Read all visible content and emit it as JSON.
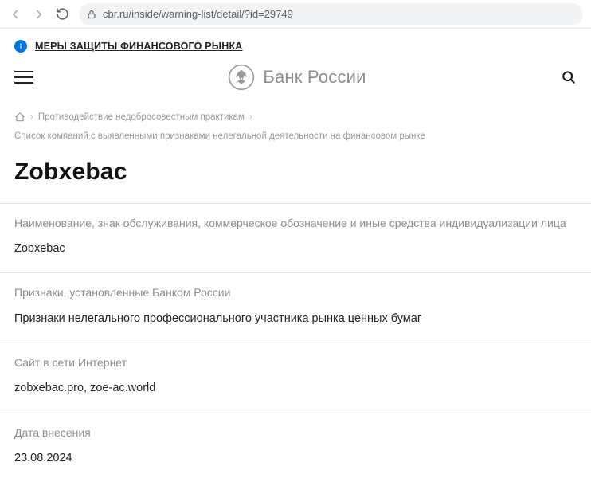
{
  "browser": {
    "url": "cbr.ru/inside/warning-list/detail/?id=29749"
  },
  "notice": {
    "text": "МЕРЫ ЗАЩИТЫ ФИНАНСОВОГО РЫНКА"
  },
  "brand": {
    "name": "Банк России"
  },
  "breadcrumb": {
    "item1": "Противодействие недобросовестным практикам",
    "item2": "Список компаний с выявленными признаками нелегальной деятельности на финансовом рынке"
  },
  "page": {
    "title": "Zobxebac"
  },
  "sections": {
    "name": {
      "label": "Наименование, знак обслуживания, коммерческое обозначение и иные средства индивидуализации лица",
      "value": "Zobxebac"
    },
    "signs": {
      "label": "Признаки, установленные Банком России",
      "value": "Признаки нелегального профессионального участника рынка ценных бумаг"
    },
    "site": {
      "label": "Сайт в сети Интернет",
      "value": "zobxebac.pro, zoe-ac.world"
    },
    "date": {
      "label": "Дата внесения",
      "value": "23.08.2024"
    }
  }
}
